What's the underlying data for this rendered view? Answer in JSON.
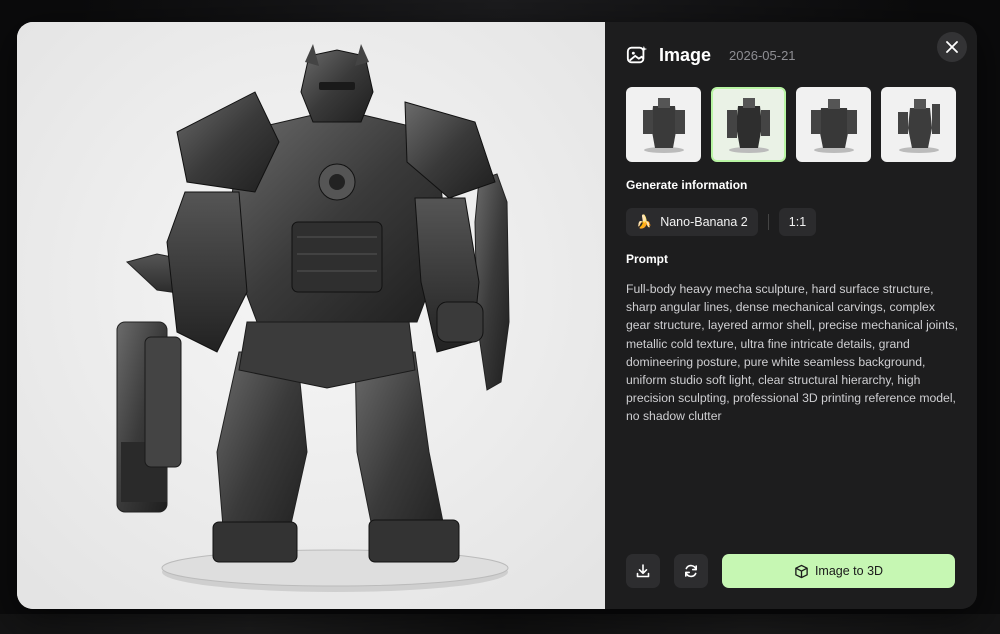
{
  "dialog": {
    "title": "Image",
    "date": "2026-05-21",
    "icons": {
      "header": "image-sparkle-icon",
      "close": "close-icon"
    }
  },
  "thumbnails": [
    {
      "name": "thumbnail-1",
      "selected": false
    },
    {
      "name": "thumbnail-2",
      "selected": true
    },
    {
      "name": "thumbnail-3",
      "selected": false
    },
    {
      "name": "thumbnail-4",
      "selected": false
    }
  ],
  "generate_info": {
    "label": "Generate information",
    "model": "Nano-Banana 2",
    "model_icon": "🍌",
    "ratio": "1:1"
  },
  "prompt": {
    "label": "Prompt",
    "text": "Full-body heavy mecha sculpture, hard surface structure, sharp angular lines, dense mechanical carvings, complex gear structure, layered armor shell, precise mechanical joints, metallic cold texture, ultra fine intricate details, grand domineering posture, pure white seamless background, uniform studio soft light, clear structural hierarchy, high precision sculpting, professional 3D printing reference model, no shadow clutter"
  },
  "actions": {
    "download_icon": "download-icon",
    "regenerate_icon": "refresh-icon",
    "primary_label": "Image to 3D",
    "primary_icon": "cube-icon"
  },
  "colors": {
    "accent": "#c6f7b3",
    "panel_bg": "#1d1d1e",
    "preview_bg": "#ececec"
  }
}
